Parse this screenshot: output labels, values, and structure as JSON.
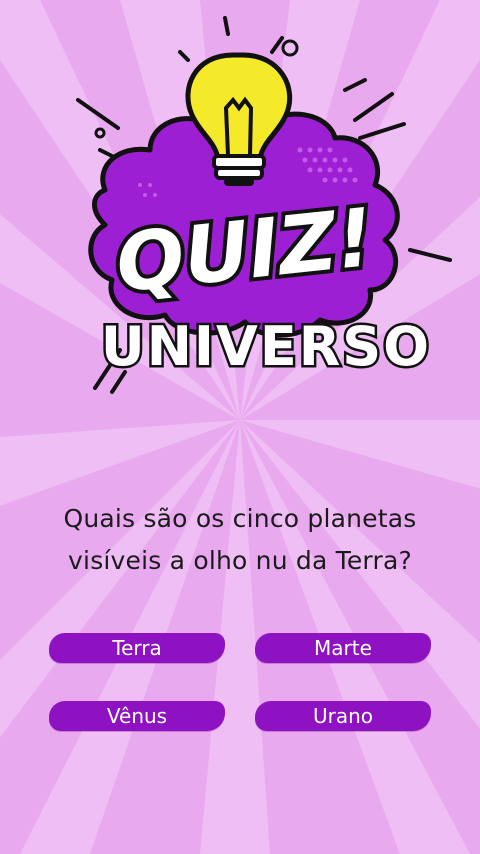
{
  "logo": {
    "quiz_text": "QUIZ!",
    "subtitle_text": "UNIVERSO"
  },
  "question": {
    "line1": "Quais são os cinco planetas",
    "line2": "visíveis a olho nu da Terra?"
  },
  "answers": [
    {
      "label": "Terra"
    },
    {
      "label": "Marte"
    },
    {
      "label": "Vênus"
    },
    {
      "label": "Urano"
    }
  ],
  "colors": {
    "background": "#e9a9ef",
    "ray": "#f1c3f5",
    "burst_purple": "#9d1fd3",
    "bulb_yellow": "#f5ea2a",
    "button_purple": "#8e12c2",
    "button_text": "#ffffff"
  }
}
